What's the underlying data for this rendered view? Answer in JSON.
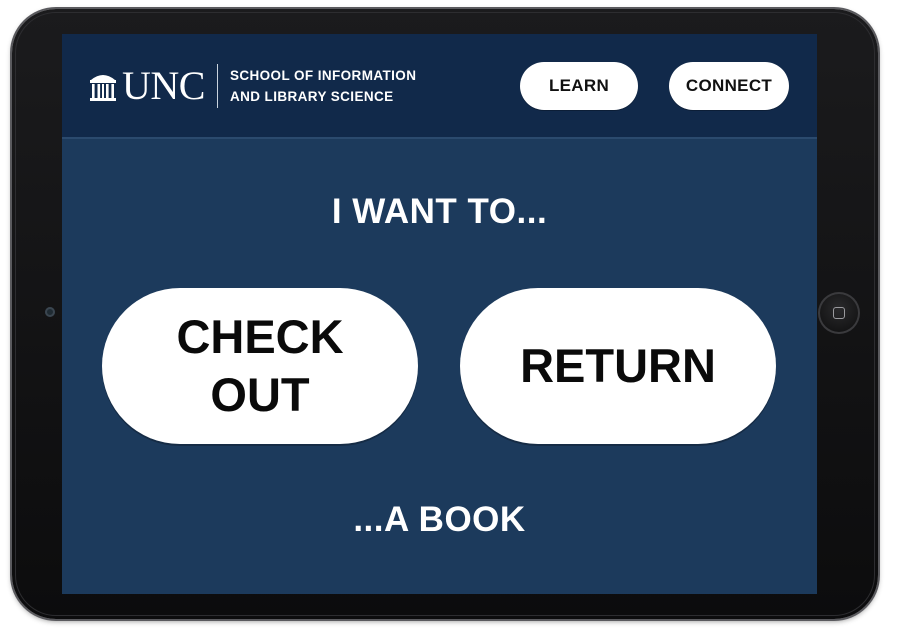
{
  "header": {
    "logo": {
      "wordmark": "UNC",
      "school_line_1": "SCHOOL OF INFORMATION",
      "school_line_2": "AND LIBRARY SCIENCE",
      "icon": "old-well-icon"
    },
    "learn_label": "LEARN",
    "connect_label": "CONNECT"
  },
  "main": {
    "prompt_top": "I WANT TO...",
    "checkout_line_1": "CHECK",
    "checkout_line_2": "OUT",
    "return_label": "RETURN",
    "prompt_bottom": "...A BOOK"
  },
  "device": {
    "home_button_icon": "home-button-icon",
    "camera_icon": "camera-icon"
  },
  "colors": {
    "screen_background": "#1c3a5c",
    "header_background": "#11294a",
    "button_background": "#ffffff",
    "button_text": "#111111",
    "text_on_dark": "#ffffff"
  }
}
